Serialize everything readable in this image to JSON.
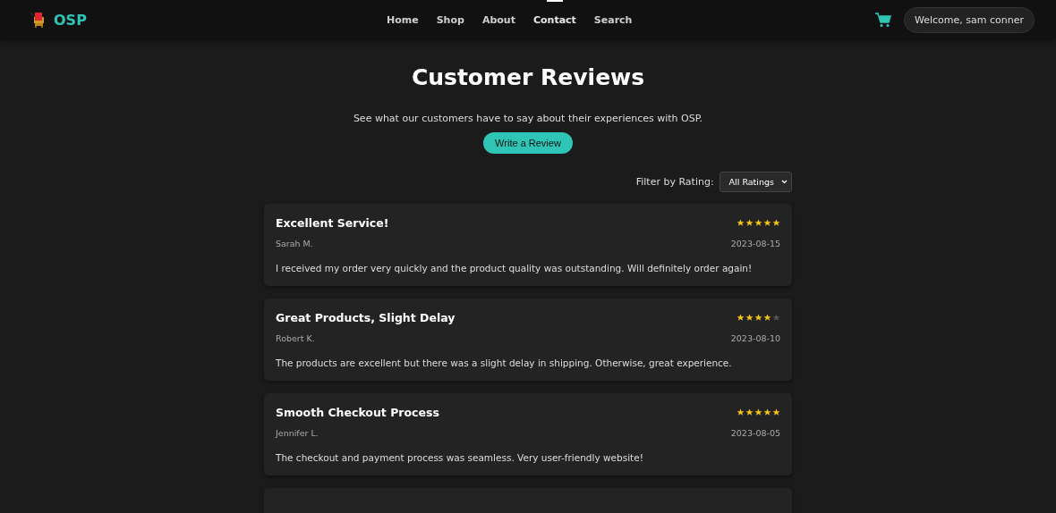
{
  "brand": {
    "name": "OSP"
  },
  "nav": [
    {
      "label": "Home",
      "selected": false
    },
    {
      "label": "Shop",
      "selected": false
    },
    {
      "label": "About",
      "selected": false
    },
    {
      "label": "Contact",
      "selected": true
    },
    {
      "label": "Search",
      "selected": false
    }
  ],
  "user": {
    "greeting": "Welcome, sam conner"
  },
  "heading": "Customer Reviews",
  "intro": "See what our customers have to say about their experiences with OSP.",
  "write_button": "Write a Review",
  "filter": {
    "label": "Filter by Rating:",
    "value": "All Ratings"
  },
  "reviews": [
    {
      "title": "Excellent Service!",
      "stars": 5,
      "author": "Sarah M.",
      "date": "2023-08-15",
      "text": "I received my order very quickly and the product quality was outstanding. Will definitely order again!"
    },
    {
      "title": "Great Products, Slight Delay",
      "stars": 4,
      "author": "Robert K.",
      "date": "2023-08-10",
      "text": "The products are excellent but there was a slight delay in shipping. Otherwise, great experience."
    },
    {
      "title": "Smooth Checkout Process",
      "stars": 5,
      "author": "Jennifer L.",
      "date": "2023-08-05",
      "text": "The checkout and payment process was seamless. Very user-friendly website!"
    }
  ]
}
